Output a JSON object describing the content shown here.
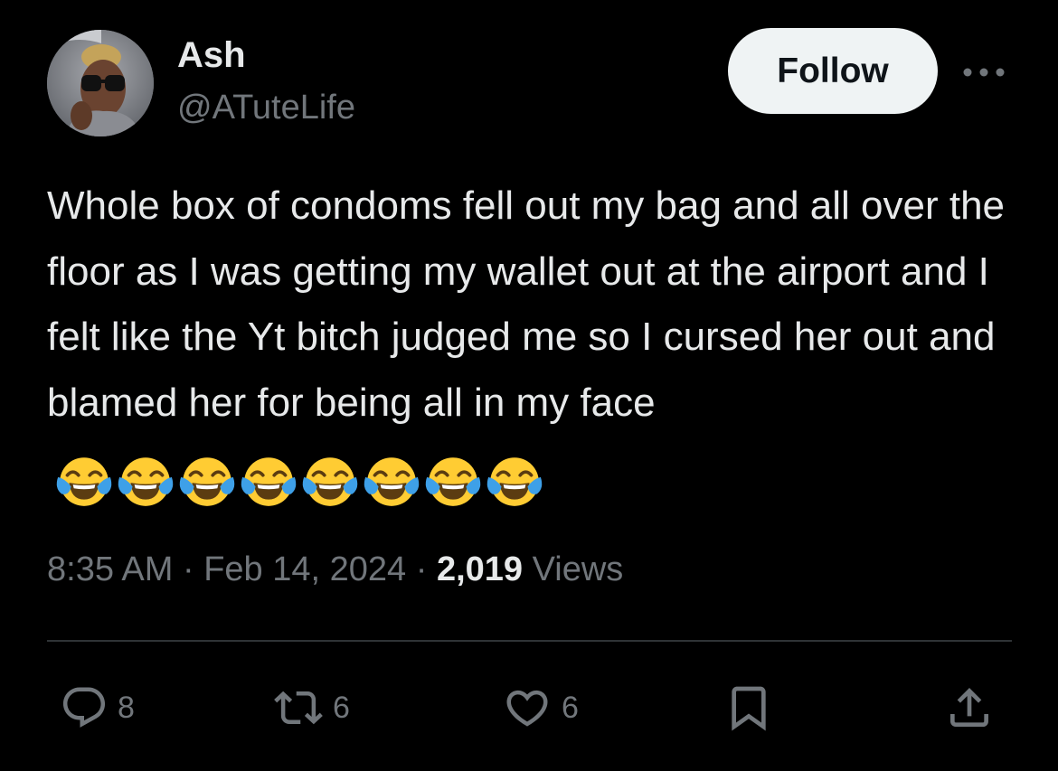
{
  "author": {
    "name": "Ash",
    "handle": "@ATuteLife"
  },
  "follow_label": "Follow",
  "tweet": {
    "text": "Whole box of condoms fell out my bag and all over the floor as I was getting my wallet out at the airport and I felt like the Yt bitch judged me so I cursed her out and blamed her for being all in my face",
    "emoji": [
      "face-with-tears-of-joy",
      "face-with-tears-of-joy",
      "face-with-tears-of-joy",
      "face-with-tears-of-joy",
      "face-with-tears-of-joy",
      "face-with-tears-of-joy",
      "face-with-tears-of-joy",
      "face-with-tears-of-joy"
    ]
  },
  "meta": {
    "time": "8:35 AM",
    "separator": "·",
    "date": "Feb 14, 2024",
    "views_count": "2,019",
    "views_label": "Views"
  },
  "actions": {
    "replies": "8",
    "reposts": "6",
    "likes": "6"
  },
  "colors": {
    "background": "#000000",
    "primary_text": "#e7e9ea",
    "secondary_text": "#71767b",
    "divider": "#2f3336",
    "follow_bg": "#eff3f4",
    "follow_text": "#0f1419"
  }
}
